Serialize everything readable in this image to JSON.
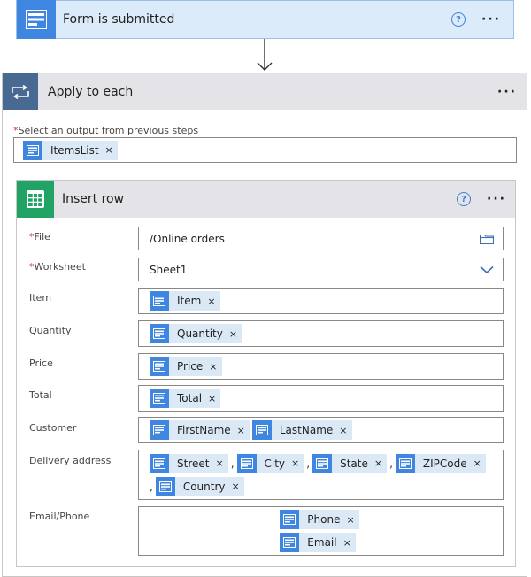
{
  "trigger": {
    "title": "Form is submitted",
    "help": "?",
    "more": "···"
  },
  "apply": {
    "title": "Apply to each",
    "more": "···",
    "select_required": "*",
    "select_label": "Select an output from previous steps",
    "select_token": "ItemsList"
  },
  "insert": {
    "title": "Insert row",
    "help": "?",
    "more": "···",
    "required_mark": "*",
    "file_label": "File",
    "file_value": "/Online orders",
    "worksheet_label": "Worksheet",
    "worksheet_value": "Sheet1",
    "item_label": "Item",
    "item_token": "Item",
    "quantity_label": "Quantity",
    "quantity_token": "Quantity",
    "price_label": "Price",
    "price_token": "Price",
    "total_label": "Total",
    "total_token": "Total",
    "customer_label": "Customer",
    "customer_tokens": [
      "FirstName",
      "LastName"
    ],
    "delivery_label": "Delivery address",
    "delivery_tokens": [
      "Street",
      "City",
      "State",
      "ZIPCode",
      "Country"
    ],
    "comma": ",",
    "contact_label": "Email/Phone",
    "contact_tokens": [
      "Phone",
      "Email"
    ],
    "remove_glyph": "×"
  },
  "colors": {
    "trigger_bg": "#dcebfa",
    "token_bg": "#dbe9f7",
    "token_icon": "#3e86e0",
    "excel_green": "#21a366",
    "loop_blue": "#486991"
  },
  "icons": {
    "trigger": "form-icon",
    "loop": "loop-icon",
    "excel": "excel-icon",
    "token": "dynamic-content-icon",
    "folder": "folder-icon",
    "dropdown": "chevron-down-icon"
  }
}
